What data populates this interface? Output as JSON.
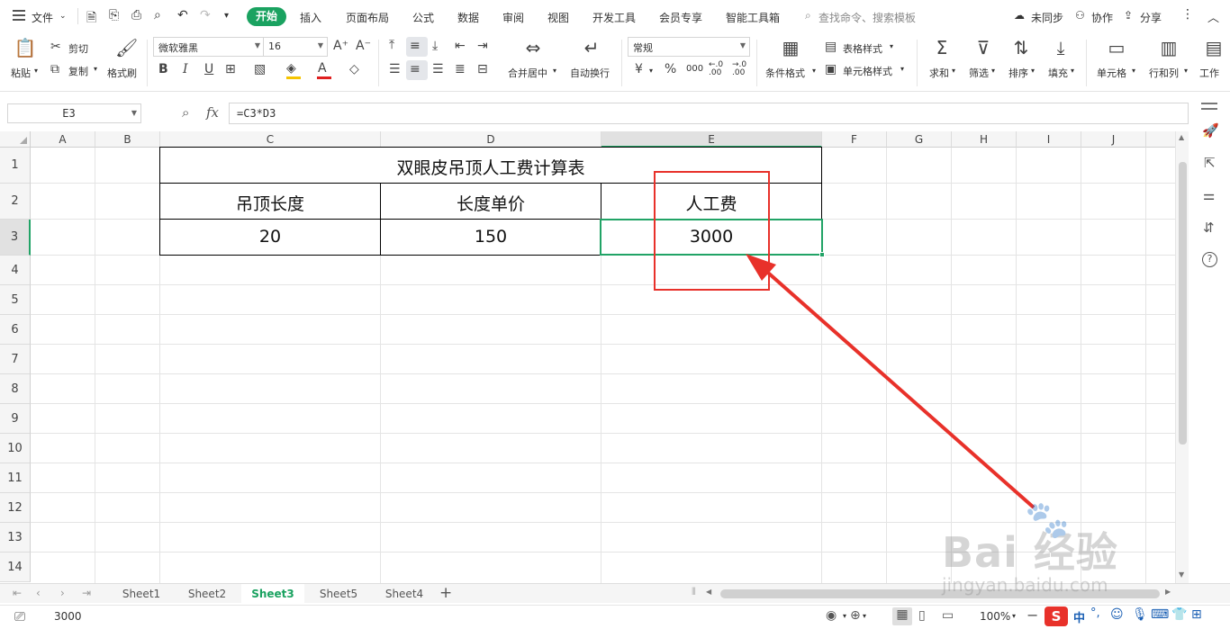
{
  "menubar": {
    "file_label": "文件",
    "tabs": [
      "开始",
      "插入",
      "页面布局",
      "公式",
      "数据",
      "审阅",
      "视图",
      "开发工具",
      "会员专享",
      "智能工具箱"
    ],
    "active_tab": "开始",
    "search_placeholder": "查找命令、搜索模板",
    "sync_label": "未同步",
    "collab_label": "协作",
    "share_label": "分享"
  },
  "ribbon": {
    "paste": "粘贴",
    "cut": "剪切",
    "copy": "复制",
    "format_painter": "格式刷",
    "font_name": "微软雅黑",
    "font_size": "16",
    "bold": "B",
    "italic": "I",
    "underline": "U",
    "merge_center": "合并居中",
    "wrap_text": "自动换行",
    "number_format": "常规",
    "currency": "¥",
    "percent": "%",
    "thousands": "000",
    "inc_decimal": "+.0\n.00",
    "dec_decimal": "-.0\n.00",
    "conditional_format": "条件格式",
    "table_style": "表格样式",
    "cell_style": "单元格样式",
    "sum": "求和",
    "filter": "筛选",
    "sort": "排序",
    "fill": "填充",
    "cells": "单元格",
    "rows_cols": "行和列",
    "worksheet": "工作"
  },
  "formula_bar": {
    "name_box": "E3",
    "fx": "fx",
    "formula": "=C3*D3"
  },
  "columns": [
    "A",
    "B",
    "C",
    "D",
    "E",
    "F",
    "G",
    "H",
    "I",
    "J"
  ],
  "rows": [
    "1",
    "2",
    "3",
    "4",
    "5",
    "6",
    "7",
    "8",
    "9",
    "10",
    "11",
    "12",
    "13",
    "14"
  ],
  "table": {
    "title": "双眼皮吊顶人工费计算表",
    "headers": [
      "吊顶长度",
      "长度单价",
      "人工费"
    ],
    "values": [
      "20",
      "150",
      "3000"
    ]
  },
  "sheets": [
    "Sheet1",
    "Sheet2",
    "Sheet3",
    "Sheet5",
    "Sheet4"
  ],
  "active_sheet": "Sheet3",
  "status": {
    "value": "3000",
    "zoom": "100%"
  },
  "watermark": {
    "brand": "Bai 经验",
    "url": "jingyan.baidu.com"
  },
  "colors": {
    "accent_green": "#1aa260",
    "selection_green": "#21a366",
    "annotation_red": "#e8312a"
  }
}
